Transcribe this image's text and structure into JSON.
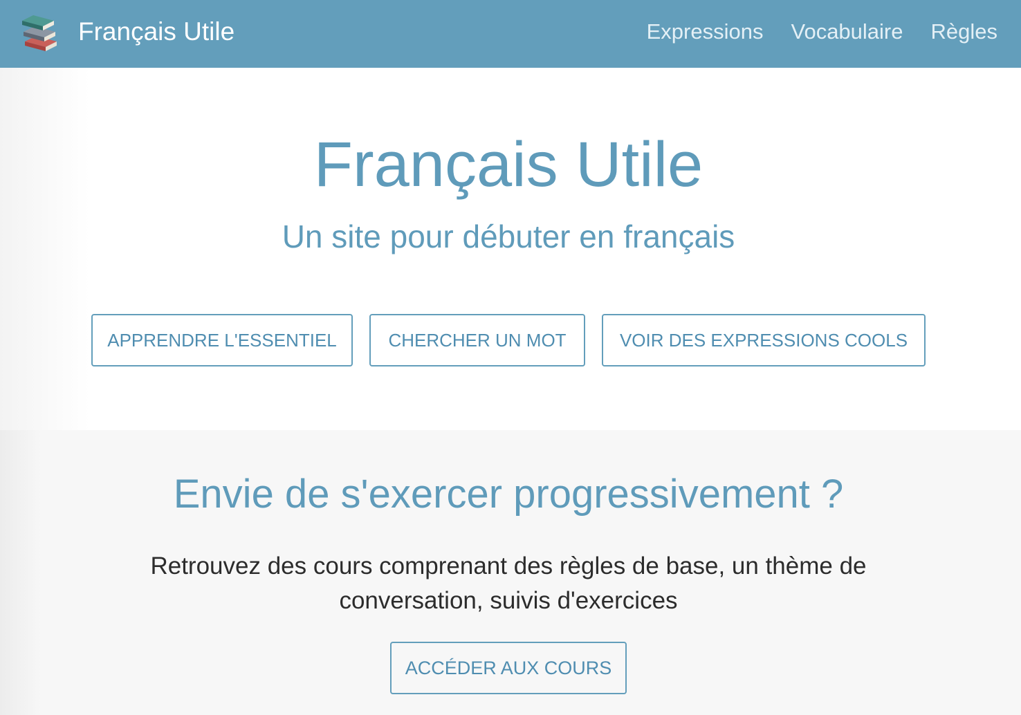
{
  "navbar": {
    "logo_icon": "books-icon",
    "brand": "Français Utile",
    "links": [
      "Expressions",
      "Vocabulaire",
      "Règles"
    ]
  },
  "hero": {
    "title": "Français Utile",
    "subtitle": "Un site pour débuter en français",
    "buttons": [
      "APPRENDRE L'ESSENTIEL",
      "CHERCHER UN MOT",
      "VOIR DES EXPRESSIONS COOLS"
    ]
  },
  "practice": {
    "title": "Envie de s'exercer progressivement ?",
    "text": "Retrouvez des cours comprenant des règles de base, un thème de conversation, suivis d'exercices",
    "button": "ACCÉDER AUX COURS"
  },
  "colors": {
    "primary": "#639ebb",
    "text_primary": "#5f9bba",
    "section_bg": "#f7f7f7"
  }
}
